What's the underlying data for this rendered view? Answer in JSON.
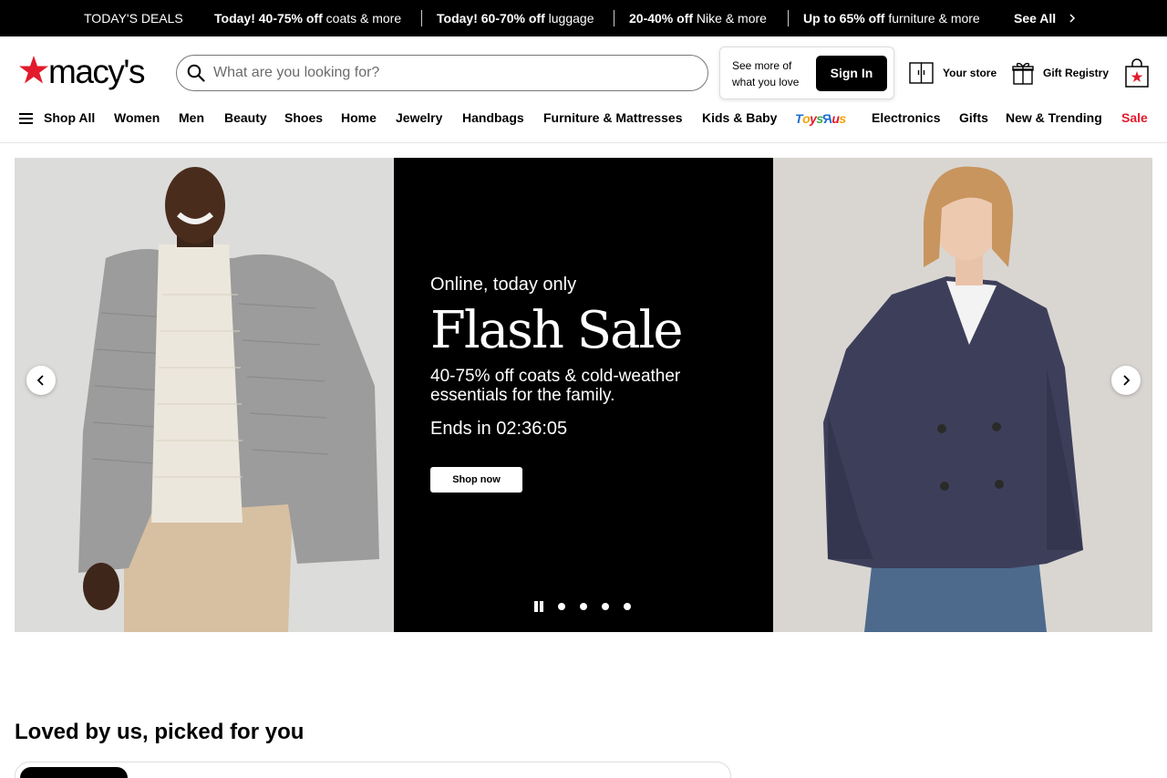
{
  "deals_bar": {
    "label": "TODAY'S DEALS",
    "deals": [
      {
        "bold": "Today! 40-75% off",
        "rest": " coats & more"
      },
      {
        "bold": "Today! 60-70% off",
        "rest": " luggage"
      },
      {
        "bold": "20-40% off",
        "rest": " Nike & more"
      },
      {
        "bold": "Up to 65% off",
        "rest": " furniture & more"
      }
    ],
    "see_all": "See All"
  },
  "header": {
    "logo_text": "macy's",
    "search_placeholder": "What are you looking for?",
    "signin_message": "See more of what you love",
    "signin_button": "Sign In",
    "your_store": "Your store",
    "gift_registry": "Gift Registry"
  },
  "nav": {
    "shop_all": "Shop All",
    "items": [
      "Women",
      "Men",
      "Beauty",
      "Shoes",
      "Home",
      "Jewelry",
      "Handbags",
      "Furniture & Mattresses",
      "Kids & Baby"
    ],
    "toys_logo": "ToysRUs",
    "items_after": [
      "Electronics",
      "Gifts",
      "New & Trending"
    ],
    "sale": "Sale"
  },
  "hero": {
    "eyebrow": "Online, today only",
    "headline": "Flash Sale",
    "description": "40-75% off coats & cold-weather essentials for the family.",
    "timer": "Ends in 02:36:05",
    "cta": "Shop now",
    "slide_count": 4
  },
  "section": {
    "title": "Loved by us, picked for you"
  },
  "colors": {
    "brand_red": "#e21a2c",
    "black": "#000000"
  }
}
